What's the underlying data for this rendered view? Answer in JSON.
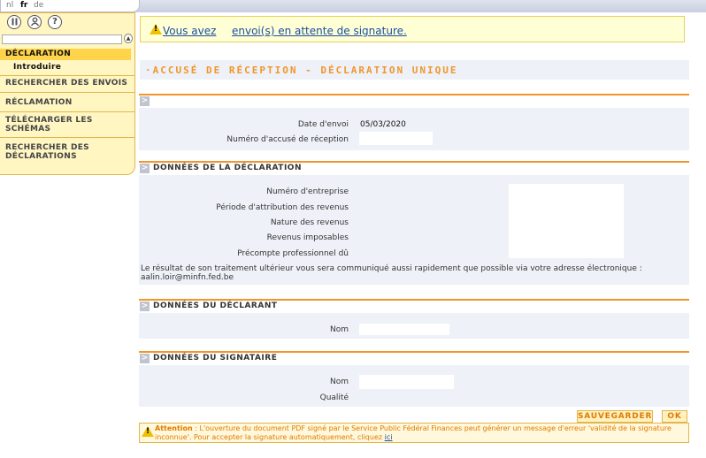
{
  "languages": [
    {
      "code": "nl",
      "active": false
    },
    {
      "code": "fr",
      "active": true
    },
    {
      "code": "de",
      "active": false
    }
  ],
  "sidebar": {
    "icons": [
      "pause-icon",
      "help-person-icon",
      "question-icon"
    ],
    "items": [
      {
        "label": "DÉCLARATION",
        "active": true
      },
      {
        "label": "Introduire",
        "sub": true
      },
      {
        "label": "RECHERCHER DES ENVOIS"
      },
      {
        "label": "RÉCLAMATION"
      },
      {
        "label": "TÉLÉCHARGER LES SCHÉMAS"
      },
      {
        "label": "RECHERCHER DES DÉCLARATIONS"
      }
    ]
  },
  "alert": {
    "link1": "Vous avez",
    "link2": "envoi(s) en attente de signature."
  },
  "page_title": "·ACCUSÉ DE RÉCEPTION - DÉCLARATION UNIQUE",
  "section_general": {
    "date_label": "Date d'envoi",
    "date_value": "05/03/2020",
    "receipt_label": "Numéro d'accusé de réception",
    "receipt_value": ""
  },
  "section_declaration": {
    "title": "DONNÉES DE LA DÉCLARATION",
    "fields": [
      {
        "label": "Numéro d'entreprise",
        "value": ""
      },
      {
        "label": "Période d'attribution des revenus",
        "value": ""
      },
      {
        "label": "Nature des revenus",
        "value": ""
      },
      {
        "label": "Revenus imposables",
        "value": ""
      },
      {
        "label": "Précompte professionnel dû",
        "value": ""
      }
    ],
    "info": "Le résultat de son traitement ultérieur vous sera communiqué aussi rapidement que possible via votre adresse électronique : aalin.loir@minfn.fed.be"
  },
  "section_declarant": {
    "title": "DONNÉES DU DÉCLARANT",
    "name_label": "Nom",
    "name_value": ""
  },
  "section_signataire": {
    "title": "DONNÉES DU SIGNATAIRE",
    "name_label": "Nom",
    "name_value": "",
    "quality_label": "Qualité",
    "quality_value": ""
  },
  "buttons": {
    "save": "SAUVEGARDER",
    "ok": "OK"
  },
  "bottom_warning": {
    "bold": "Attention",
    "text": " : L'ouverture du document PDF signé par le Service Public Fédéral Finances peut générer un message d'erreur 'validité de la signature inconnue'. Pour accepter la signature automatiquement, cliquez ",
    "link": "ici"
  },
  "colors": {
    "accent_orange": "#f0962a",
    "sidebar_bg": "#fff6c2",
    "sidebar_active": "#ffd34a",
    "link_blue": "#1a4fa0",
    "section_bg": "#eef1f7"
  }
}
